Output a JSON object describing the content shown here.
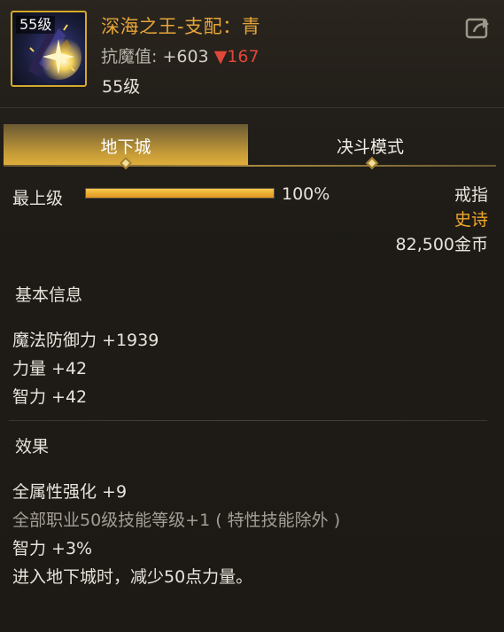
{
  "header": {
    "item_level_tag": "55级",
    "title": "深海之王-支配：青",
    "resist_label": "抗魔值:",
    "resist_value": "+603",
    "resist_diff": "▼167",
    "level_text": "55级",
    "share_icon": "share-icon"
  },
  "tabs": [
    {
      "label": "地下城",
      "active": true
    },
    {
      "label": "决斗模式",
      "active": false
    }
  ],
  "upgrade": {
    "label": "最上级",
    "progress_percent": 100,
    "percent_text": "100%"
  },
  "item_info": {
    "type": "戒指",
    "rarity": "史诗",
    "price": "82,500金币"
  },
  "colors": {
    "accent_gold": "#e6a53a",
    "rarity_epic": "#f0a72b",
    "diff_down": "#e0473a",
    "muted": "#a39e94"
  },
  "basic_info": {
    "title": "基本信息",
    "stats": [
      "魔法防御力 +1939",
      "力量 +42",
      "智力 +42"
    ]
  },
  "effects": {
    "title": "效果",
    "lines": [
      "全属性强化 +9",
      "全部职业50级技能等级+1 ( 特性技能除外 )",
      "智力 +3%",
      "进入地下城时，减少50点力量。"
    ]
  }
}
